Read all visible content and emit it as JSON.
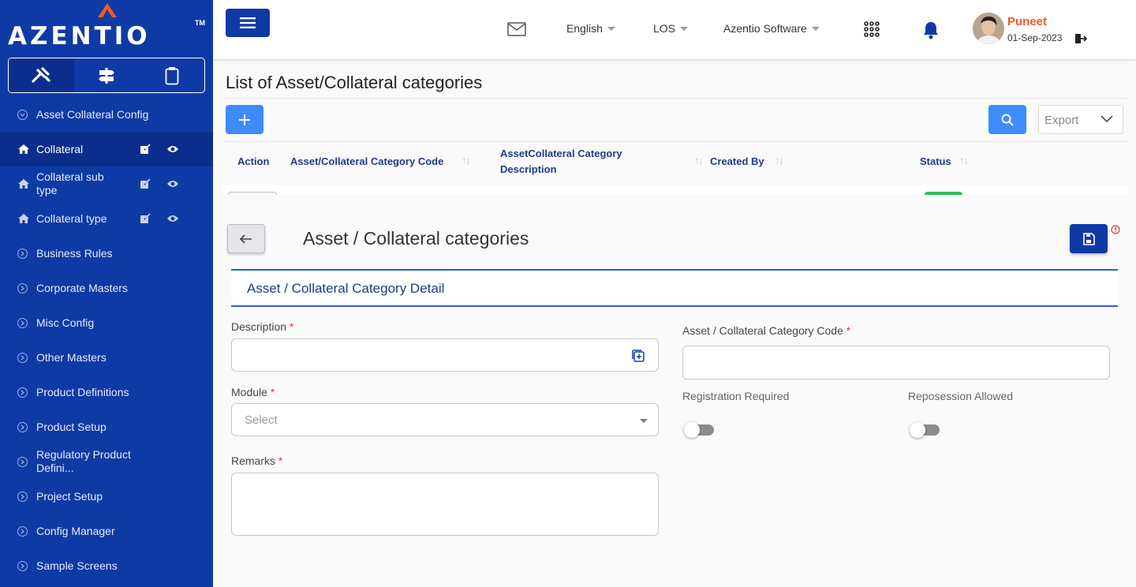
{
  "brand": {
    "name": "AZENTIO",
    "tm": "TM"
  },
  "sidebar": {
    "tabs": [
      {
        "icon": "tools-icon"
      },
      {
        "icon": "signpost-icon"
      },
      {
        "icon": "clipboard-icon"
      }
    ],
    "items": [
      {
        "label": "Asset Collateral Config"
      },
      {
        "label": "Collateral"
      },
      {
        "label": "Collateral sub type"
      },
      {
        "label": "Collateral type"
      },
      {
        "label": "Business Rules"
      },
      {
        "label": "Corporate Masters"
      },
      {
        "label": "Misc Config"
      },
      {
        "label": "Other Masters"
      },
      {
        "label": "Product Definitions"
      },
      {
        "label": "Product Setup"
      },
      {
        "label": "Regulatory Product Defini..."
      },
      {
        "label": "Project Setup"
      },
      {
        "label": "Config Manager"
      },
      {
        "label": "Sample Screens"
      }
    ]
  },
  "topbar": {
    "language": "English",
    "module": "LOS",
    "company": "Azentio Software",
    "user_name": "Puneet",
    "date": "01-Sep-2023"
  },
  "list": {
    "title": "List of Asset/Collateral categories",
    "export_label": "Export",
    "columns": [
      "Action",
      "Asset/Collateral Category Code",
      "AssetCollateral Category",
      "Description",
      "Created By",
      "Status"
    ]
  },
  "detail": {
    "title": "Asset / Collateral categories",
    "section": "Asset / Collateral Category Detail",
    "fields": {
      "description": {
        "label": "Description",
        "value": ""
      },
      "module": {
        "label": "Module",
        "placeholder": "Select"
      },
      "remarks": {
        "label": "Remarks",
        "value": ""
      },
      "category_code": {
        "label": "Asset / Collateral Category Code",
        "value": ""
      },
      "registration_required": {
        "label": "Registration Required",
        "on": false
      },
      "repossession_allowed": {
        "label": "Reposession Allowed",
        "on": false
      }
    },
    "required_mark": "*"
  },
  "colors": {
    "sidebar": "#0f3aa5",
    "primary": "#3d8bfd",
    "accent": "#f15a22"
  }
}
